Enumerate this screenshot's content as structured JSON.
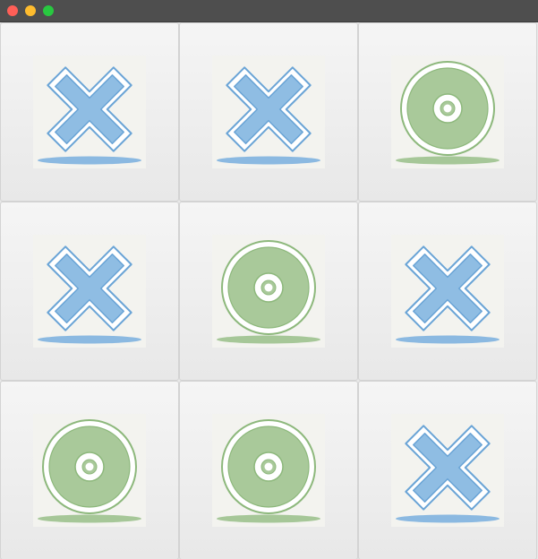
{
  "window": {
    "buttons": [
      {
        "name": "close",
        "color": "#ff5f57"
      },
      {
        "name": "minimize",
        "color": "#febc2e"
      },
      {
        "name": "maximize",
        "color": "#28c840"
      }
    ]
  },
  "colors": {
    "x_fill": "#8fbde3",
    "x_stroke": "#6aa4d6",
    "x_shadow": "#7fb2df",
    "o_fill": "#a9c99a",
    "o_stroke": "#8db87c",
    "o_shadow": "#9dc28e",
    "tile_background": "#f3f3ef"
  },
  "board": {
    "size": 3,
    "cells": [
      {
        "mark": "X",
        "icon": "x-mark-icon"
      },
      {
        "mark": "X",
        "icon": "x-mark-icon"
      },
      {
        "mark": "O",
        "icon": "o-mark-icon"
      },
      {
        "mark": "X",
        "icon": "x-mark-icon"
      },
      {
        "mark": "O",
        "icon": "o-mark-icon"
      },
      {
        "mark": "X",
        "icon": "x-mark-icon"
      },
      {
        "mark": "O",
        "icon": "o-mark-icon"
      },
      {
        "mark": "O",
        "icon": "o-mark-icon"
      },
      {
        "mark": "X",
        "icon": "x-mark-icon"
      }
    ]
  }
}
